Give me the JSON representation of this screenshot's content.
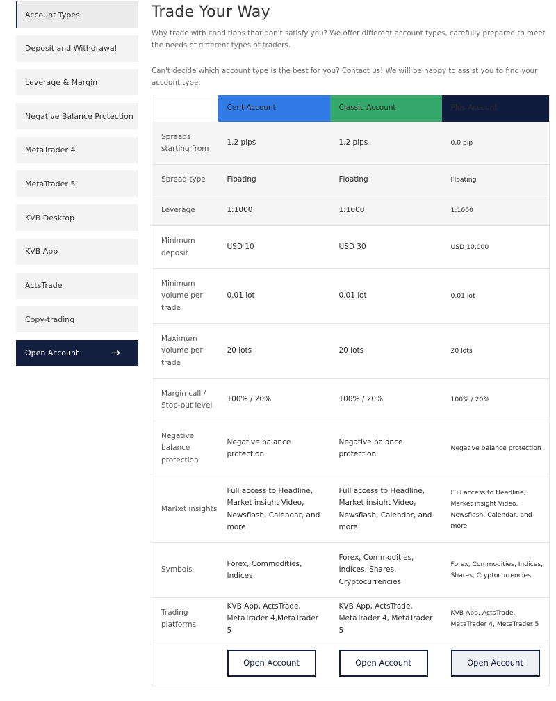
{
  "sidebar": {
    "items": [
      {
        "label": "Account Types"
      },
      {
        "label": "Deposit and Withdrawal"
      },
      {
        "label": "Leverage & Margin"
      },
      {
        "label": "Negative Balance Protection"
      },
      {
        "label": "MetaTrader 4"
      },
      {
        "label": "MetaTrader 5"
      },
      {
        "label": "KVB Desktop"
      },
      {
        "label": "KVB App"
      },
      {
        "label": "ActsTrade"
      },
      {
        "label": "Copy-trading"
      }
    ],
    "cta_label": "Open Account",
    "cta_arrow": "→"
  },
  "main": {
    "title": "Trade Your Way",
    "intro": "Why trade with conditions that don't satisfy you? We offer different account types, carefully prepared to meet the needs of different types of traders.",
    "intro2": "Can't decide which account type is the best for you? Contact us! We will be happy to assist you to find your account type."
  },
  "accounts": {
    "cent": "Cent Account",
    "classic": "Classic Account",
    "plus": "Plus Account"
  },
  "colors": {
    "cent": "#2f7ae5",
    "classic": "#35a86b",
    "plus": "#101c3e"
  },
  "rows": [
    {
      "label": "Spreads starting from",
      "cent": "1.2 pips",
      "classic": "1.2 pips",
      "plus": "0.0 pip"
    },
    {
      "label": "Spread type",
      "cent": "Floating",
      "classic": "Floating",
      "plus": "Floating"
    },
    {
      "label": "Leverage",
      "cent": "1:1000",
      "classic": "1:1000",
      "plus": "1:1000"
    },
    {
      "label": "Minimum deposit",
      "cent": "USD 10",
      "classic": "USD 30",
      "plus": "USD 10,000"
    },
    {
      "label": "Minimum volume per trade",
      "cent": "0.01 lot",
      "classic": "0.01 lot",
      "plus": "0.01 lot"
    },
    {
      "label": "Maximum volume per trade",
      "cent": "20 lots",
      "classic": "20 lots",
      "plus": "20 lots"
    },
    {
      "label": "Margin call / Stop-out level",
      "cent": "100% / 20%",
      "classic": "100% / 20%",
      "plus": "100% / 20%"
    },
    {
      "label": "Negative balance protection",
      "cent": "Negative balance protection",
      "classic": "Negative balance protection",
      "plus": "Negative balance protection"
    },
    {
      "label": "Market insights",
      "cent": "Full access to Headline, Market insight Video, Newsflash, Calendar, and more",
      "classic": "Full access to Headline, Market insight Video, Newsflash, Calendar, and more",
      "plus": "Full access to Headline, Market insight Video, Newsflash, Calendar, and more"
    },
    {
      "label": "Symbols",
      "cent": "Forex, Commodities, Indices",
      "classic": "Forex, Commodities, Indices, Shares, Cryptocurrencies",
      "plus": "Forex, Commodities, Indices, Shares, Cryptocurrencies"
    },
    {
      "label": "Trading platforms",
      "cent": "KVB App, ActsTrade, MetaTrader 4,MetaTrader 5",
      "classic": "KVB App, ActsTrade, MetaTrader 4, MetaTrader 5",
      "plus": "KVB App, ActsTrade, MetaTrader 4, MetaTrader 5"
    }
  ],
  "buttons": {
    "cent": "Open Account",
    "classic": "Open Account",
    "plus": "Open Account"
  }
}
